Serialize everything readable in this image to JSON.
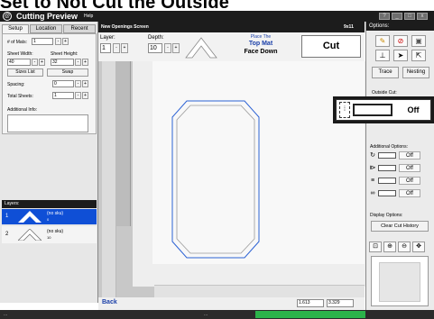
{
  "heading": "Set to Not Cut the Outside",
  "app": {
    "logo": "@",
    "title": "Cutting Preview",
    "help_menu": "Help",
    "window_buttons": [
      "?",
      "_",
      "□",
      "x"
    ]
  },
  "left_panel": {
    "tabs": [
      "Setup",
      "Location",
      "Recent"
    ],
    "num_mats_label": "# of Mats:",
    "num_mats_value": "1",
    "sheet_width_label": "Sheet Width:",
    "sheet_width_value": "40",
    "sheet_height_label": "Sheet Height:",
    "sheet_height_value": "32",
    "sizes_list_label": "Sizes List",
    "swap_label": "Swap",
    "spacing_label": "Spacing:",
    "spacing_value": "0",
    "total_sheets_label": "Total Sheets:",
    "total_sheets_value": "1",
    "additional_info_label": "Additional Info:",
    "stepper_minus": "-",
    "stepper_plus": "+",
    "layers_header": "Layers:",
    "layers": [
      {
        "num": "1",
        "name": "(no sku)",
        "sub": "0",
        "selected": true
      },
      {
        "num": "2",
        "name": "(no sku)",
        "sub": "10",
        "selected": false
      }
    ]
  },
  "center": {
    "header": "New Openings Screen",
    "size": "9x11",
    "layer_label": "Layer:",
    "layer_value": "1",
    "depth_label": "Depth:",
    "depth_value": "10",
    "place_line1": "Place The",
    "place_line2": "Top Mat",
    "place_line3": "Face Down",
    "cut_label": "Cut",
    "back_label": "Back",
    "coord_x": "1.613",
    "coord_y": "3.329"
  },
  "right_panel": {
    "header": "Options:",
    "trace_label": "Trace",
    "nesting_label": "Nesting",
    "outside_cut_label": "Outside Cut:",
    "outside_cut_state": "Off",
    "additional_options_label": "Additional Options:",
    "options": [
      {
        "icon": "rotate-icon",
        "glyph": "↻",
        "state": "Off"
      },
      {
        "icon": "mirror-icon",
        "glyph": "⧐",
        "state": "Off"
      },
      {
        "icon": "bevel-icon",
        "glyph": "≡",
        "state": "Off"
      },
      {
        "icon": "infinity-icon",
        "glyph": "∞",
        "state": "Off"
      }
    ],
    "display_options_label": "Display Options:",
    "clear_cut_history_label": "Clear Cut History"
  },
  "colors": {
    "dark_bar": "#1c1c1c",
    "selection": "#0f4fd6",
    "link_blue": "#1a3fa8",
    "cut_line": "#2d63d4",
    "status_green": "#2bb34a"
  },
  "icons": {
    "toolbar": [
      "pencil-icon",
      "no-icon",
      "panel-icon",
      "push-pin-icon",
      "pointer-icon",
      "resize-icon"
    ],
    "zoom": [
      "zoom-fit-icon",
      "zoom-in-icon",
      "zoom-out-icon",
      "pan-icon"
    ]
  },
  "status": {
    "left_text": "...",
    "mid_text": "..."
  }
}
